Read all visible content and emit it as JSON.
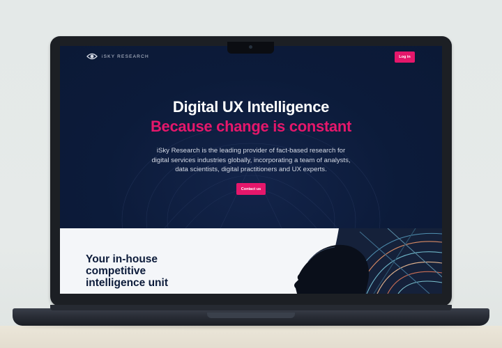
{
  "brand": {
    "name": "iSKY RESEARCH",
    "logo_icon": "eye-icon"
  },
  "header": {
    "login_label": "Log in"
  },
  "hero": {
    "title": "Digital UX Intelligence",
    "subtitle": "Because change is constant",
    "description_lines": [
      "iSky Research is the leading provider of fact-based research for",
      "digital services industries globally, incorporating a team of analysts,",
      "data scientists, digital practitioners and UX experts."
    ],
    "contact_label": "Contact us"
  },
  "section2": {
    "title_lines": [
      "Your in-house",
      "competitive",
      "intelligence unit"
    ]
  },
  "colors": {
    "navy": "#0c1b3a",
    "accent_pink": "#e5176b",
    "light_bg": "#f4f6f9"
  }
}
